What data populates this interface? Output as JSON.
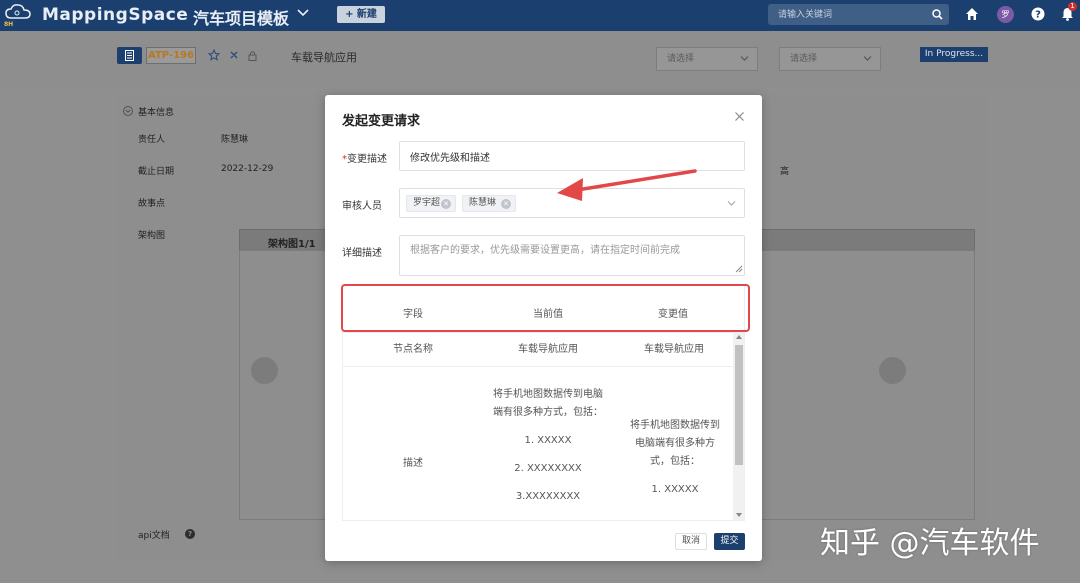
{
  "topbar": {
    "logo_sub": "8H",
    "brand": "MappingSpace",
    "project": "汽车项目模板",
    "new_button": "+ 新建",
    "search_placeholder": "请输入关键词",
    "avatar": "罗",
    "bell_count": "1",
    "colors": {
      "bg": "#1b3f6e",
      "badge": "#d0312d"
    }
  },
  "issue": {
    "id": "ATP-196",
    "title": "车载导航应用",
    "select1": "请选择",
    "select2": "请选择",
    "status": "In Progress..."
  },
  "basic_info": {
    "section_label": "基本信息",
    "fields": [
      {
        "label": "责任人",
        "value": "陈慧琳"
      },
      {
        "label": "截止日期",
        "value": "2022-12-29"
      },
      {
        "label": "故事点",
        "value": ""
      },
      {
        "label": "架构图",
        "value": ""
      }
    ],
    "priority": "高",
    "arch_tab": "架构图1/1",
    "api_label": "api文档",
    "api_help": "?"
  },
  "modal": {
    "title": "发起变更请求",
    "change_desc": {
      "label": "变更描述",
      "required_mark": "*",
      "value": "修改优先级和描述"
    },
    "reviewers": {
      "label": "审核人员",
      "tags": [
        "罗宇超",
        "陈慧琳"
      ]
    },
    "detail": {
      "label": "详细描述",
      "placeholder": "根据客户的要求，优先级需要设置更高，请在指定时间前完成"
    },
    "table": {
      "headers": [
        "字段",
        "当前值",
        "变更值"
      ],
      "rows": [
        {
          "field": "节点名称",
          "current": "车载导航应用",
          "changed": "车载导航应用"
        },
        {
          "field": "描述",
          "current_lines": [
            "将手机地图数据传到电脑",
            "端有很多种方式，包括：",
            "1. XXXXX",
            "2. XXXXXXXX",
            "3.XXXXXXXX"
          ],
          "changed_lines": [
            "将手机地图数据传到",
            "电脑端有很多种方",
            "式，包括：",
            "1. XXXXX"
          ]
        }
      ]
    },
    "cancel": "取消",
    "submit": "提交"
  },
  "watermark": "知乎 @汽车软件",
  "colors": {
    "accent": "#1b3f6e",
    "annotation": "#e24848",
    "required": "#d0312d"
  }
}
